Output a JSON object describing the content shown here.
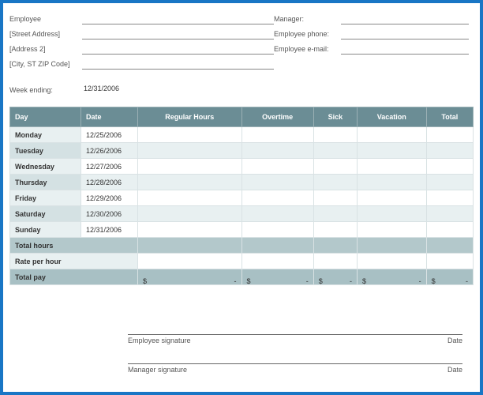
{
  "info_left": {
    "employee_label": "Employee",
    "employee_value": "",
    "street_label": "[Street Address]",
    "street_value": "",
    "address2_label": "[Address 2]",
    "address2_value": "",
    "city_label": "[City, ST  ZIP Code]",
    "city_value": "",
    "weekending_label": "Week ending:",
    "weekending_value": "12/31/2006"
  },
  "info_right": {
    "manager_label": "Manager:",
    "manager_value": "",
    "phone_label": "Employee phone:",
    "phone_value": "",
    "email_label": "Employee e-mail:",
    "email_value": ""
  },
  "headers": {
    "day": "Day",
    "date": "Date",
    "regular": "Regular Hours",
    "overtime": "Overtime",
    "sick": "Sick",
    "vacation": "Vacation",
    "total": "Total"
  },
  "rows": [
    {
      "day": "Monday",
      "date": "12/25/2006",
      "regular": "",
      "overtime": "",
      "sick": "",
      "vacation": "",
      "total": ""
    },
    {
      "day": "Tuesday",
      "date": "12/26/2006",
      "regular": "",
      "overtime": "",
      "sick": "",
      "vacation": "",
      "total": ""
    },
    {
      "day": "Wednesday",
      "date": "12/27/2006",
      "regular": "",
      "overtime": "",
      "sick": "",
      "vacation": "",
      "total": ""
    },
    {
      "day": "Thursday",
      "date": "12/28/2006",
      "regular": "",
      "overtime": "",
      "sick": "",
      "vacation": "",
      "total": ""
    },
    {
      "day": "Friday",
      "date": "12/29/2006",
      "regular": "",
      "overtime": "",
      "sick": "",
      "vacation": "",
      "total": ""
    },
    {
      "day": "Saturday",
      "date": "12/30/2006",
      "regular": "",
      "overtime": "",
      "sick": "",
      "vacation": "",
      "total": ""
    },
    {
      "day": "Sunday",
      "date": "12/31/2006",
      "regular": "",
      "overtime": "",
      "sick": "",
      "vacation": "",
      "total": ""
    }
  ],
  "summary": {
    "total_hours_label": "Total hours",
    "rate_label": "Rate per hour",
    "total_pay_label": "Total pay",
    "currency": "$",
    "dash": "-",
    "total_hours": {
      "regular": "",
      "overtime": "",
      "sick": "",
      "vacation": "",
      "total": ""
    },
    "rate": {
      "regular": "",
      "overtime": "",
      "sick": "",
      "vacation": "",
      "total": ""
    }
  },
  "signatures": {
    "emp_label": "Employee signature",
    "mgr_label": "Manager signature",
    "date_label": "Date"
  }
}
